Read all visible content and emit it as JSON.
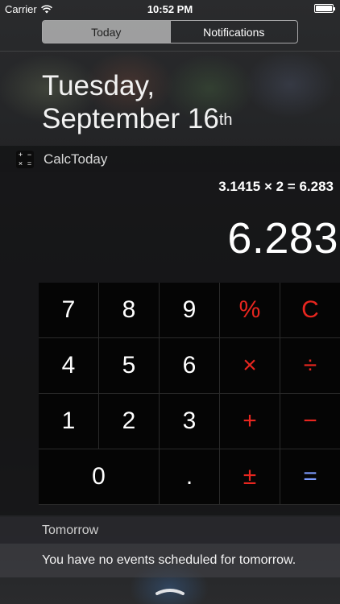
{
  "status_bar": {
    "carrier": "Carrier",
    "time": "10:52 PM",
    "wifi_icon": "wifi-icon",
    "battery_icon": "battery-icon"
  },
  "tabs": [
    {
      "label": "Today",
      "active": true
    },
    {
      "label": "Notifications",
      "active": false
    }
  ],
  "date": {
    "weekday": "Tuesday,",
    "month_day": "September 16",
    "suffix": "th"
  },
  "widget": {
    "name": "CalcToday",
    "icon": "calculator-icon",
    "icon_glyphs": [
      "+",
      "−",
      "×",
      "="
    ],
    "expression": "3.1415 × 2 = 6.283",
    "display": "6.283",
    "keys": [
      {
        "label": "7",
        "name": "key-7",
        "style": "digit"
      },
      {
        "label": "8",
        "name": "key-8",
        "style": "digit"
      },
      {
        "label": "9",
        "name": "key-9",
        "style": "digit"
      },
      {
        "label": "%",
        "name": "key-percent",
        "style": "red"
      },
      {
        "label": "C",
        "name": "key-clear",
        "style": "red"
      },
      {
        "label": "4",
        "name": "key-4",
        "style": "digit"
      },
      {
        "label": "5",
        "name": "key-5",
        "style": "digit"
      },
      {
        "label": "6",
        "name": "key-6",
        "style": "digit"
      },
      {
        "label": "×",
        "name": "key-multiply",
        "style": "red"
      },
      {
        "label": "÷",
        "name": "key-divide",
        "style": "red"
      },
      {
        "label": "1",
        "name": "key-1",
        "style": "digit"
      },
      {
        "label": "2",
        "name": "key-2",
        "style": "digit"
      },
      {
        "label": "3",
        "name": "key-3",
        "style": "digit"
      },
      {
        "label": "+",
        "name": "key-plus",
        "style": "red"
      },
      {
        "label": "−",
        "name": "key-minus",
        "style": "red"
      },
      {
        "label": "0",
        "name": "key-0",
        "style": "zero"
      },
      {
        "label": ".",
        "name": "key-decimal",
        "style": "digit"
      },
      {
        "label": "±",
        "name": "key-plus-minus",
        "style": "red"
      },
      {
        "label": "=",
        "name": "key-equals",
        "style": "blue"
      }
    ]
  },
  "tomorrow": {
    "label": "Tomorrow",
    "events_text": "You have no events scheduled for tomorrow."
  },
  "colors": {
    "operator_red": "#e8261f",
    "equals_blue": "#7d9cff"
  }
}
